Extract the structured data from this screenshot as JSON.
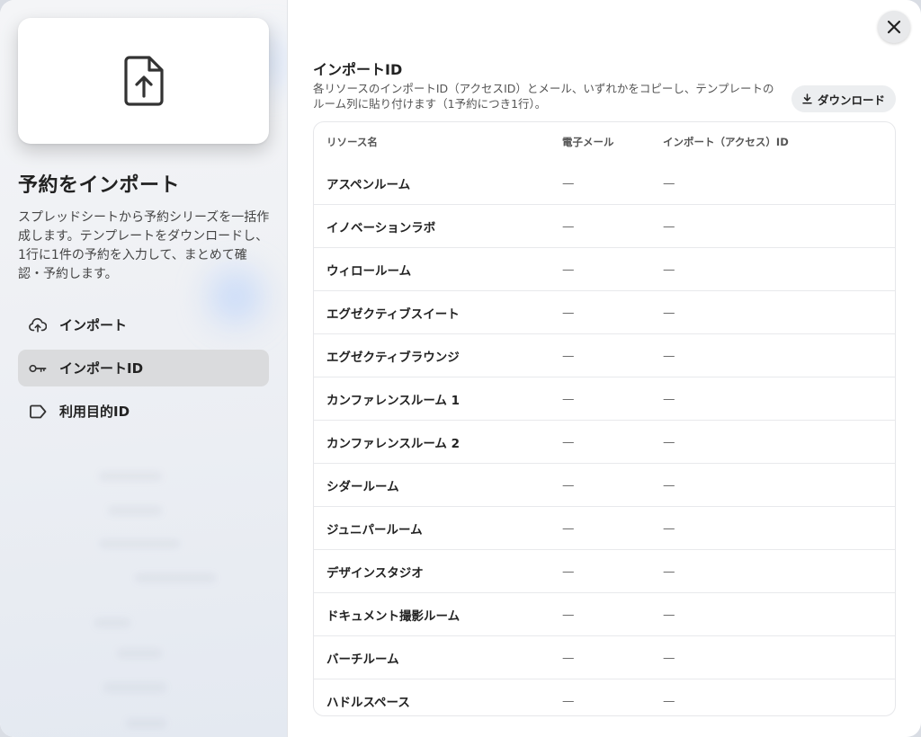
{
  "sidebar": {
    "title": "予約をインポート",
    "description": "スプレッドシートから予約シリーズを一括作成します。テンプレートをダウンロードし、1行に1件の予約を入力して、まとめて確認・予約します。",
    "nav": [
      {
        "label": "インポート",
        "icon": "cloud-upload-icon",
        "active": false
      },
      {
        "label": "インポートID",
        "icon": "key-icon",
        "active": true
      },
      {
        "label": "利用目的ID",
        "icon": "tag-icon",
        "active": false
      }
    ]
  },
  "main": {
    "title": "インポートID",
    "description": "各リソースのインポートID（アクセスID）とメール、いずれかをコピーし、テンプレートのルーム列に貼り付けます（1予約につき1行）。",
    "download_label": "ダウンロード",
    "table": {
      "headers": [
        "リソース名",
        "電子メール",
        "インポート（アクセス）ID"
      ],
      "rows": [
        [
          "アスペンルーム",
          "—",
          "—"
        ],
        [
          "イノベーションラボ",
          "—",
          "—"
        ],
        [
          "ウィロールーム",
          "—",
          "—"
        ],
        [
          "エグゼクティブスイート",
          "—",
          "—"
        ],
        [
          "エグゼクティブラウンジ",
          "—",
          "—"
        ],
        [
          "カンファレンスルーム 1",
          "—",
          "—"
        ],
        [
          "カンファレンスルーム 2",
          "—",
          "—"
        ],
        [
          "シダールーム",
          "—",
          "—"
        ],
        [
          "ジュニパールーム",
          "—",
          "—"
        ],
        [
          "デザインスタジオ",
          "—",
          "—"
        ],
        [
          "ドキュメント撮影ルーム",
          "—",
          "—"
        ],
        [
          "バーチルーム",
          "—",
          "—"
        ],
        [
          "ハドルスペース",
          "—",
          "—"
        ]
      ]
    }
  }
}
